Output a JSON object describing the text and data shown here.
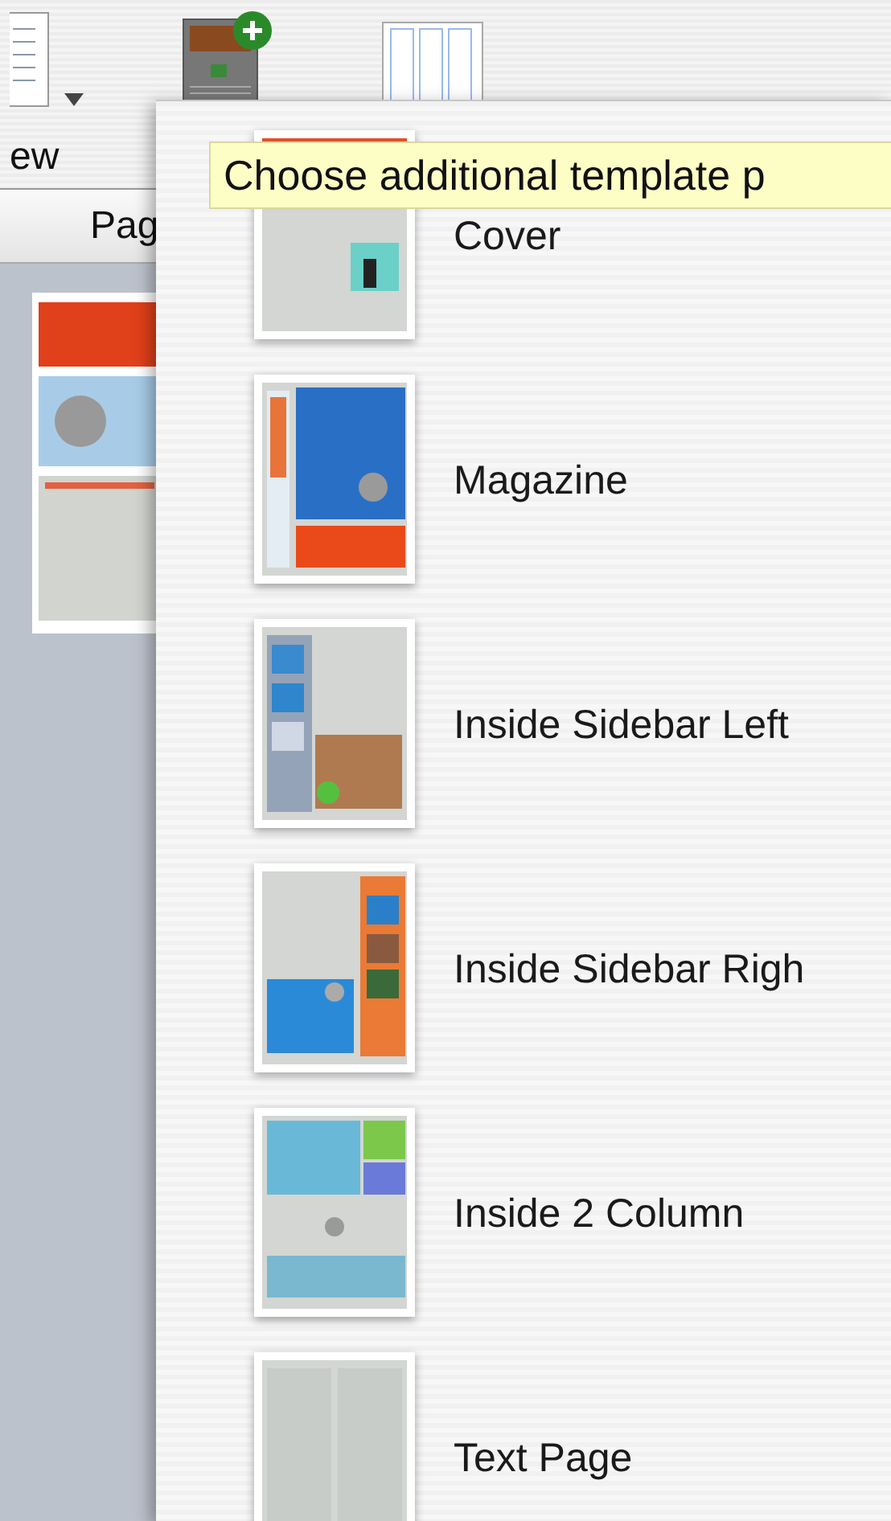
{
  "toolbar": {
    "label": "ew"
  },
  "sidebar": {
    "header": "Pag"
  },
  "template_menu": {
    "items": [
      {
        "label": "Cover"
      },
      {
        "label": "Magazine"
      },
      {
        "label": "Inside Sidebar Left"
      },
      {
        "label": "Inside Sidebar Righ"
      },
      {
        "label": "Inside 2 Column"
      },
      {
        "label": "Text Page"
      }
    ]
  },
  "tooltip": "Choose additional template p"
}
